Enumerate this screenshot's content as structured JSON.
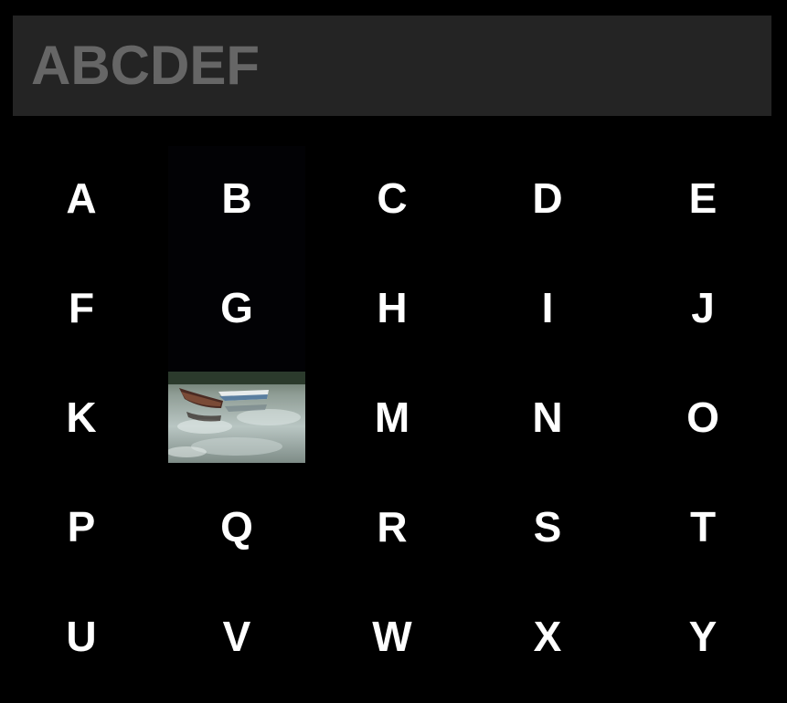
{
  "input": {
    "value": "ABCDEF"
  },
  "keys": [
    {
      "label": "A"
    },
    {
      "label": "B"
    },
    {
      "label": "C"
    },
    {
      "label": "D"
    },
    {
      "label": "E"
    },
    {
      "label": "F"
    },
    {
      "label": "G"
    },
    {
      "label": "H"
    },
    {
      "label": "I"
    },
    {
      "label": "J"
    },
    {
      "label": "K"
    },
    {
      "label": "",
      "image": "rowboats-on-lake-photo"
    },
    {
      "label": "M"
    },
    {
      "label": "N"
    },
    {
      "label": "O"
    },
    {
      "label": "P"
    },
    {
      "label": "Q"
    },
    {
      "label": "R"
    },
    {
      "label": "S"
    },
    {
      "label": "T"
    },
    {
      "label": "U"
    },
    {
      "label": "V"
    },
    {
      "label": "W"
    },
    {
      "label": "X"
    },
    {
      "label": "Y"
    }
  ],
  "colors": {
    "background": "#000000",
    "input_background": "#242424",
    "input_text": "#666666",
    "key_text": "#ffffff"
  }
}
